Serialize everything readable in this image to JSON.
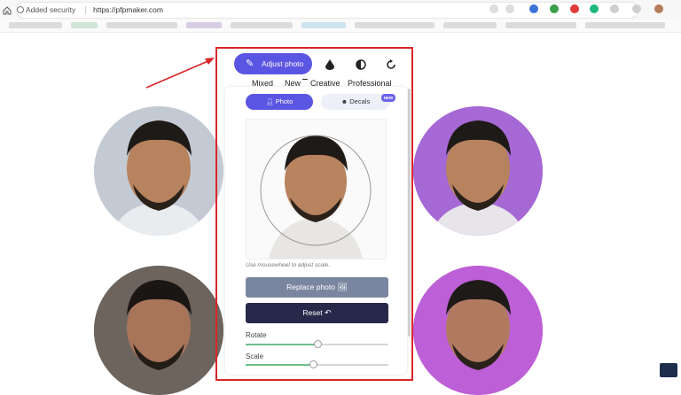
{
  "browser": {
    "security_label": "Added security",
    "url": "https://pfpmaker.com"
  },
  "toolbar": {
    "adjust_label": "Adjust photo",
    "tabs": [
      "Mixed",
      "New",
      "Creative",
      "Professional"
    ]
  },
  "panel": {
    "photo_label": "Photo",
    "decals_label": "Decals",
    "new_badge": "NEW",
    "hint": "Use mousewheel to adjust scale.",
    "replace_label": "Replace photo",
    "reset_label": "Reset",
    "rotate_label": "Rotate",
    "scale_label": "Scale",
    "rotate_value": 0.5,
    "scale_value": 0.47
  },
  "colors": {
    "accent": "#5b55e3",
    "highlight": "#d9262a",
    "reset_bg": "#27294a"
  }
}
